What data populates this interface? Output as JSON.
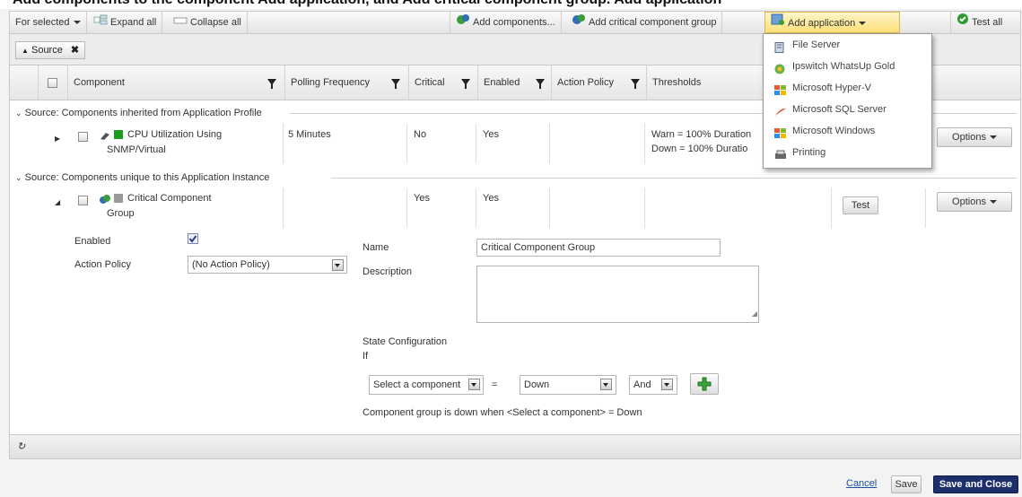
{
  "page_header": {
    "partial_text": "Add components to the component Add application, and Add critical component group. Add application"
  },
  "toolbar": {
    "for_selected": "For selected",
    "expand_all": "Expand all",
    "collapse_all": "Collapse all",
    "add_components": "Add components...",
    "add_critical_group": "Add critical component group",
    "add_application": "Add application",
    "test_all": "Test all"
  },
  "grouping": {
    "chip_label": "Source",
    "chip_remove": "✖"
  },
  "columns": {
    "component": "Component",
    "polling_frequency": "Polling Frequency",
    "critical": "Critical",
    "enabled": "Enabled",
    "action_policy": "Action Policy",
    "thresholds": "Thresholds"
  },
  "groups": [
    {
      "label": "Source: Components inherited from Application Profile"
    },
    {
      "label": "Source: Components unique to this Application Instance"
    }
  ],
  "rows": [
    {
      "name_line1": "CPU Utilization Using",
      "name_line2": "SNMP/Virtual",
      "polling": "5 Minutes",
      "critical": "No",
      "enabled": "Yes",
      "threshold_warn": "Warn = 100% Duration",
      "threshold_down": "Down = 100% Duratio",
      "options": "Options",
      "status_color": "#1a9e1a"
    },
    {
      "name_line1": "Critical Component",
      "name_line2": "Group",
      "critical": "Yes",
      "enabled": "Yes",
      "test": "Test",
      "options": "Options",
      "status_color": "#9a9a9a"
    }
  ],
  "detail": {
    "enabled_label": "Enabled",
    "enabled_checked": true,
    "action_policy_label": "Action Policy",
    "action_policy_value": "(No Action Policy)",
    "name_label": "Name",
    "name_value": "Critical Component Group",
    "description_label": "Description",
    "description_value": "",
    "state_config_label": "State Configuration",
    "if_label": "If",
    "select_component": "Select a component",
    "equals": "=",
    "state_value": "Down",
    "logic_value": "And",
    "summary": "Component group is down when <Select a component> = Down"
  },
  "footer": {
    "cancel": "Cancel",
    "save": "Save",
    "save_and_close": "Save and Close"
  },
  "app_menu": {
    "items": [
      {
        "label": "File Server",
        "icon": "file-server-icon"
      },
      {
        "label": "Ipswitch WhatsUp Gold",
        "icon": "whatsup-gold-icon"
      },
      {
        "label": "Microsoft Hyper-V",
        "icon": "hyper-v-icon"
      },
      {
        "label": "Microsoft SQL Server",
        "icon": "sql-server-icon"
      },
      {
        "label": "Microsoft Windows",
        "icon": "windows-icon"
      },
      {
        "label": "Printing",
        "icon": "printer-icon"
      }
    ]
  },
  "colors": {
    "primary_button": "#1c2f6b",
    "link": "#1a4fa0",
    "menu_highlight": "#fde07a"
  }
}
